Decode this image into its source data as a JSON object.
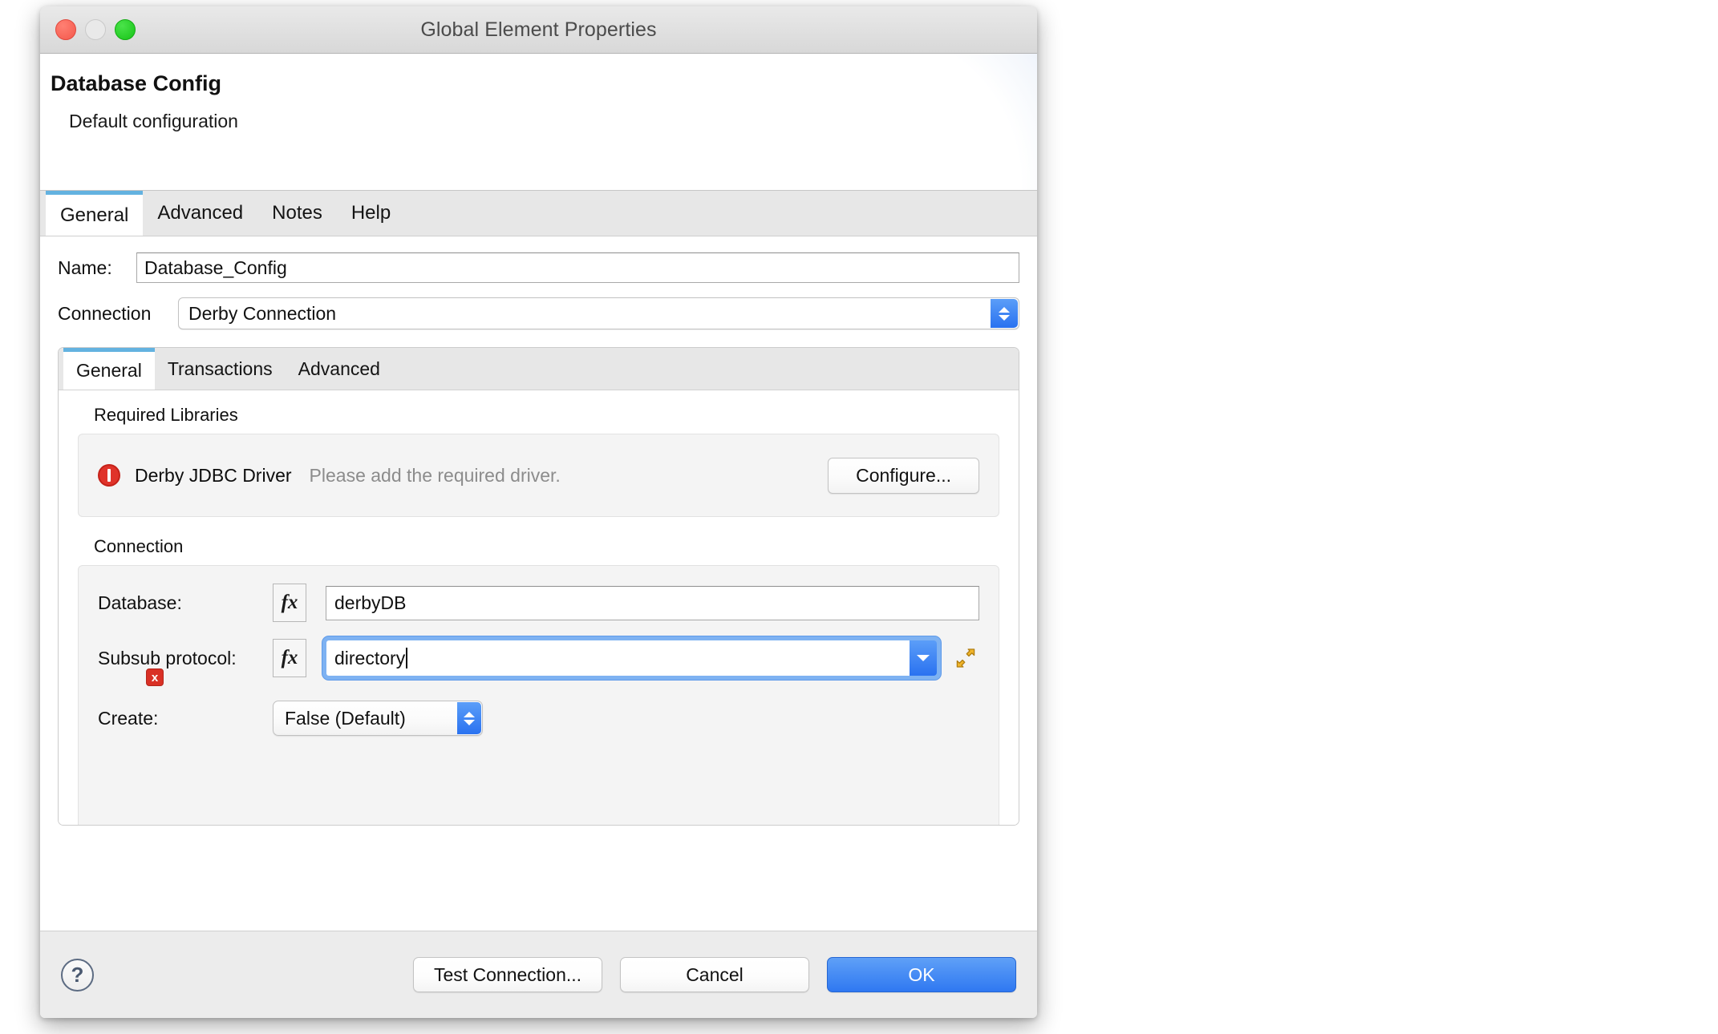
{
  "window": {
    "title": "Global Element Properties",
    "traffic_lights": [
      "close-red",
      "minimize-gray",
      "zoom-green"
    ]
  },
  "header": {
    "title": "Database Config",
    "subtitle": "Default configuration"
  },
  "outer_tabs": [
    {
      "label": "General",
      "active": true
    },
    {
      "label": "Advanced",
      "active": false
    },
    {
      "label": "Notes",
      "active": false
    },
    {
      "label": "Help",
      "active": false
    }
  ],
  "form": {
    "name_label": "Name:",
    "name_value": "Database_Config",
    "connection_label": "Connection",
    "connection_value": "Derby Connection"
  },
  "inner_tabs": [
    {
      "label": "General",
      "active": true
    },
    {
      "label": "Transactions",
      "active": false
    },
    {
      "label": "Advanced",
      "active": false
    }
  ],
  "required_libraries": {
    "group_label": "Required Libraries",
    "driver_name": "Derby JDBC Driver",
    "status_message": "Please add the required driver.",
    "configure_label": "Configure...",
    "status_icon": "error-circle-icon",
    "status_color": "#e0332a"
  },
  "connection_group": {
    "group_label": "Connection",
    "database_label": "Database:",
    "database_value": "derbyDB",
    "subsub_label": "Subsub protocol:",
    "subsub_value": "directory",
    "subsub_error_badge": "x",
    "create_label": "Create:",
    "create_value": "False (Default)",
    "fx_label": "fx"
  },
  "footer": {
    "help_label": "?",
    "test_connection_label": "Test Connection...",
    "cancel_label": "Cancel",
    "ok_label": "OK",
    "ok_color": "#2f78f1"
  }
}
